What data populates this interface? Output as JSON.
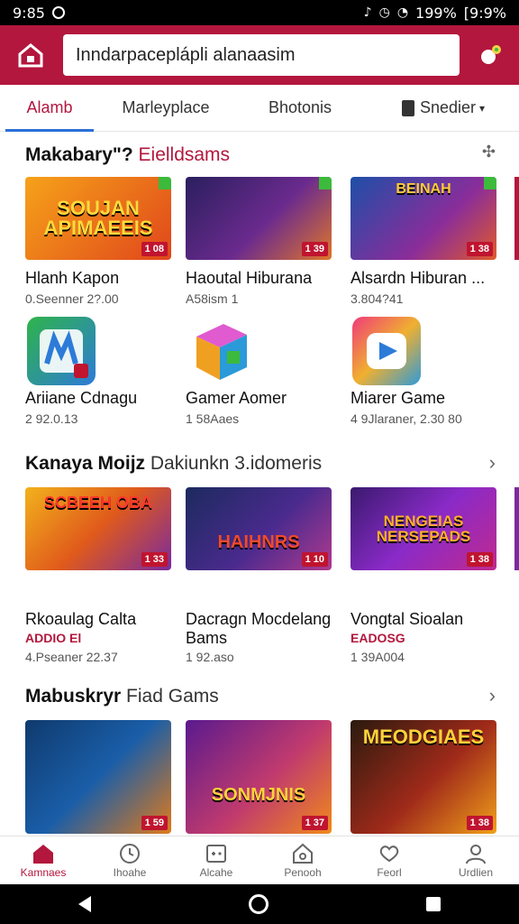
{
  "status_bar": {
    "time": "9:85",
    "battery": "199%",
    "clock_right": "[9:9%"
  },
  "search": {
    "value": "Inndarpaceplápli alanaasim"
  },
  "tabs": [
    {
      "label": "Alamb",
      "active": true
    },
    {
      "label": "Marleyplace",
      "active": false
    },
    {
      "label": "Bhotonis",
      "active": false
    },
    {
      "label": "Snedier",
      "active": false
    }
  ],
  "sections": [
    {
      "title": "Makabary\"? ",
      "subtitle": "Eielldsams",
      "tiles": [
        {
          "banner": "SOUJAN APIMAEEIS",
          "badge": "1 08",
          "name": "Hlanh Kapon",
          "meta": "0.Seenner 2?.00"
        },
        {
          "banner": "",
          "badge": "1 39",
          "name": "Haoutal Hiburana",
          "meta": "A58ism 1"
        },
        {
          "banner": "BEINAH",
          "badge": "1 38",
          "name": "Alsardn Hiburan ...",
          "meta": "3.804?41"
        }
      ],
      "apps": [
        {
          "name": "Ariiane Cdnagu",
          "meta": "2 92.0.13"
        },
        {
          "name": "Gamer Aomer",
          "meta": "1 58Aaes"
        },
        {
          "name": "Miarer Game",
          "meta": "4 9Jlaraner, 2.30 80"
        }
      ]
    },
    {
      "title": "Kanaya Moijz ",
      "subtitle": "Dakiunkn 3.idomeris",
      "tiles": [
        {
          "banner": "SCBEEH OBA",
          "badge": "1 33",
          "name": "Rkoaulag Calta",
          "name2": "",
          "meta_red": "ADDIO El",
          "meta": "4.Pseaner 22.37"
        },
        {
          "banner": "HAIHNRS",
          "badge": "1 10",
          "name": "Dacragn Mocdelang",
          "name2": "Bams",
          "meta_red": "",
          "meta": "1 92.aso"
        },
        {
          "banner": "NENGEIAS NERSEPADS",
          "badge": "1 38",
          "name": "Vongtal Sioalan",
          "name2": "",
          "meta_red": "EADOSG",
          "meta": "1 39A004"
        }
      ]
    },
    {
      "title": "Mabuskryr ",
      "subtitle": "Fiad Gams",
      "tiles": [
        {
          "banner": "",
          "badge": "1 59",
          "name": "",
          "meta": ""
        },
        {
          "banner": "SONMJNIS",
          "badge": "1 37",
          "name": "",
          "meta": ""
        },
        {
          "banner": "MEODGIAES",
          "badge": "1 38",
          "name": "",
          "meta": ""
        }
      ]
    }
  ],
  "bottom_nav": [
    {
      "label": "Kamnaes",
      "icon": "home-icon",
      "active": true
    },
    {
      "label": "Ihoahe",
      "icon": "clock-icon",
      "active": false
    },
    {
      "label": "Alcahe",
      "icon": "gamepad-icon",
      "active": false
    },
    {
      "label": "Penooh",
      "icon": "house-outline-icon",
      "active": false
    },
    {
      "label": "Feorl",
      "icon": "heart-chat-icon",
      "active": false
    },
    {
      "label": "Urdlien",
      "icon": "user-icon",
      "active": false
    }
  ],
  "colors": {
    "brand": "#b3173d",
    "tab_underline": "#2b6fd6",
    "badge": "#c0142f"
  }
}
